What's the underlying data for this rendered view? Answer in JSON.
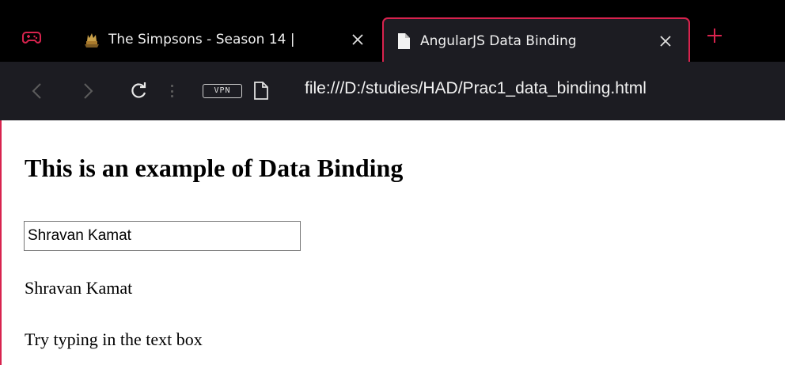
{
  "browser": {
    "tabs": [
      {
        "title": "The Simpsons - Season 14 | ",
        "favicon": "simpsons-favicon",
        "active": false
      },
      {
        "title": "AngularJS Data Binding",
        "favicon": "document-icon",
        "active": true
      }
    ],
    "address": {
      "vpn_label": "VPN",
      "url": "file:///D:/studies/HAD/Prac1_data_binding.html"
    },
    "colors": {
      "accent": "#d8234e",
      "tabstrip_bg": "#000000",
      "toolbar_bg": "#1c1c22"
    }
  },
  "page": {
    "heading": "This is an example of Data Binding",
    "input_value": "Shravan Kamat",
    "bound_output": "Shravan Kamat",
    "hint": "Try typing in the text box"
  }
}
